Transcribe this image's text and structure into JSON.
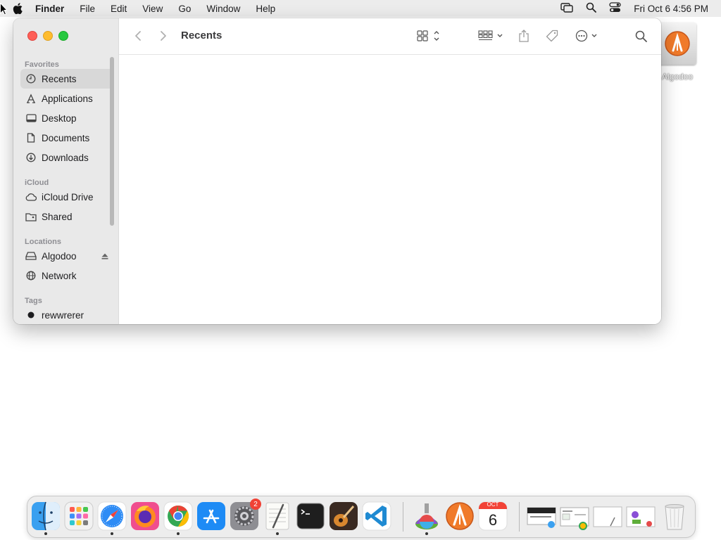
{
  "menubar": {
    "app_name": "Finder",
    "items": [
      "File",
      "Edit",
      "View",
      "Go",
      "Window",
      "Help"
    ],
    "datetime": "Fri Oct 6  4:56 PM"
  },
  "desktop": {
    "icons": [
      {
        "label": "Algodoo",
        "icon": "external-disk-icon"
      }
    ]
  },
  "finder": {
    "title": "Recents",
    "sidebar": {
      "favorites_title": "Favorites",
      "favorites": [
        {
          "label": "Recents",
          "icon": "clock-icon",
          "selected": true
        },
        {
          "label": "Applications",
          "icon": "applications-icon"
        },
        {
          "label": "Desktop",
          "icon": "desktop-icon"
        },
        {
          "label": "Documents",
          "icon": "document-icon"
        },
        {
          "label": "Downloads",
          "icon": "download-icon"
        }
      ],
      "icloud_title": "iCloud",
      "icloud": [
        {
          "label": "iCloud Drive",
          "icon": "cloud-icon"
        },
        {
          "label": "Shared",
          "icon": "shared-folder-icon"
        }
      ],
      "locations_title": "Locations",
      "locations": [
        {
          "label": "Algodoo",
          "icon": "drive-icon",
          "ejectable": true
        },
        {
          "label": "Network",
          "icon": "globe-icon"
        }
      ],
      "tags_title": "Tags",
      "tags": [
        {
          "label": "rewwrerer",
          "color": "#1d1d1f"
        }
      ]
    }
  },
  "dock": {
    "apps": [
      "Finder",
      "Launchpad",
      "Safari",
      "Firefox",
      "Chrome",
      "App Store",
      "System Settings",
      "TextEdit",
      "Terminal",
      "Instruments",
      "Visual Studio Code",
      "Preview",
      "Algodoo",
      "Calendar"
    ],
    "settings_badge": "2",
    "calendar_month": "OCT",
    "calendar_day": "6",
    "trash": "Trash"
  },
  "colors": {
    "close": "#fe5f57",
    "minimize": "#febc2e",
    "maximize": "#28c840",
    "sidebar_bg": "#e9e9e9",
    "accent_blue": "#1c7cf5"
  }
}
